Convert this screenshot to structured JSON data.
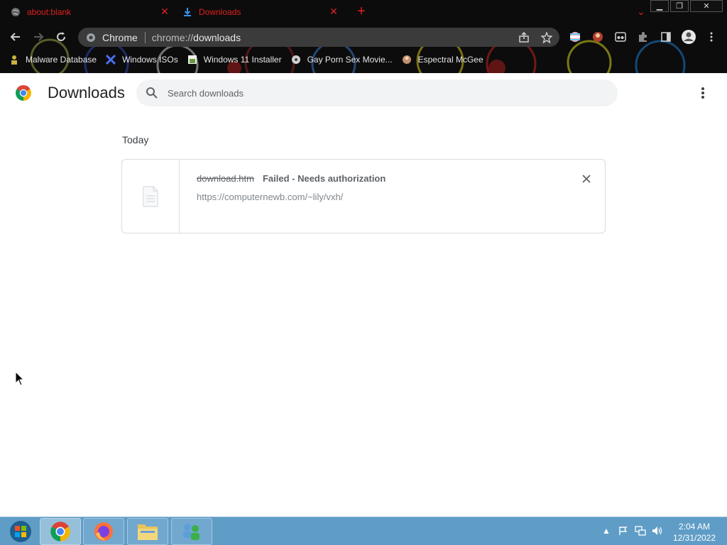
{
  "browser": {
    "tabs": [
      {
        "title": "about:blank",
        "icon": "globe-icon",
        "active": false
      },
      {
        "title": "Downloads",
        "icon": "download-icon",
        "active": true
      }
    ],
    "omnibox": {
      "site_label": "Chrome",
      "url_prefix": "chrome://",
      "url_path": "downloads"
    },
    "bookmarks": [
      {
        "label": "Malware Database",
        "icon": "person-icon"
      },
      {
        "label": "Windows ISOs",
        "icon": "x-logo-icon"
      },
      {
        "label": "Windows 11 Installer",
        "icon": "installer-icon"
      },
      {
        "label": "Gay Porn Sex Movie...",
        "icon": "pad-icon"
      },
      {
        "label": "Espectral McGee",
        "icon": "avatar-icon"
      }
    ],
    "accent_color": "#e0201e"
  },
  "page": {
    "title": "Downloads",
    "search_placeholder": "Search downloads",
    "date_heading": "Today",
    "items": [
      {
        "file_name": "download.htm",
        "status": "Failed - Needs authorization",
        "url": "https://computernewb.com/~lily/vxh/",
        "file_icon": "file-icon"
      }
    ]
  },
  "taskbar": {
    "apps": [
      "start-orb-icon",
      "chrome-icon",
      "firefox-icon",
      "folder-icon",
      "network-users-icon"
    ],
    "clock_time": "2:04 AM",
    "clock_date": "12/31/2022"
  }
}
